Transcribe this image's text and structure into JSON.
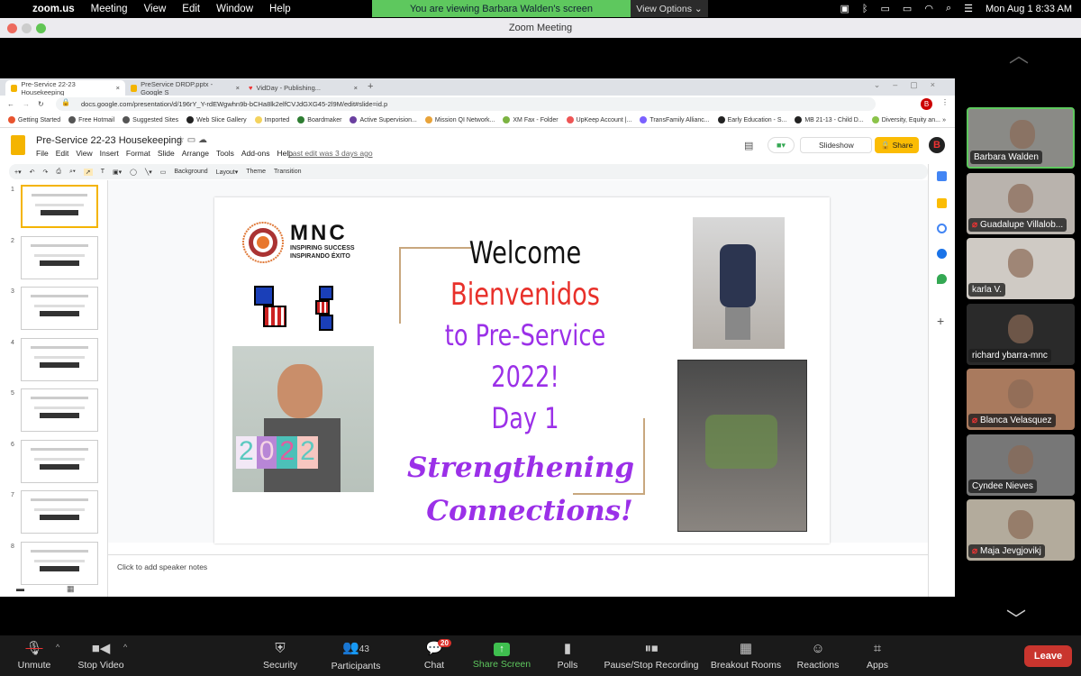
{
  "menubar": {
    "app": "zoom.us",
    "items": [
      "Meeting",
      "View",
      "Edit",
      "Window",
      "Help"
    ],
    "clock": "Mon Aug 1  8:33 AM"
  },
  "banner": {
    "viewing": "You are viewing Barbara Walden's screen",
    "view_options": "View Options ⌄"
  },
  "window": {
    "title": "Zoom Meeting"
  },
  "browser": {
    "tabs": [
      {
        "label": "Pre-Service 22-23 Housekeeping"
      },
      {
        "label": "PreService DRDP.pptx - Google S"
      },
      {
        "label": "VidDay - Publishing..."
      }
    ],
    "url": "docs.google.com/presentation/d/196rY_Y-rdEWgwhn9b-bCHa8lk2elfCVJdGXG45-2l9M/edit#slide=id.p",
    "bookmarks": [
      "Getting Started",
      "Free Hotmail",
      "Suggested Sites",
      "Web Slice Gallery",
      "Imported",
      "Boardmaker",
      "Active Supervision...",
      "Mission QI Network...",
      "XM Fax - Folder",
      "UpKeep Account |...",
      "TransFamily Allianc...",
      "Early Education - S...",
      "MB 21-13 - Child D...",
      "Diversity, Equity an..."
    ],
    "profile": "B"
  },
  "slides": {
    "doc_title": "Pre-Service 22-23 Housekeeping",
    "menu": [
      "File",
      "Edit",
      "View",
      "Insert",
      "Format",
      "Slide",
      "Arrange",
      "Tools",
      "Add-ons",
      "Help"
    ],
    "last_edit": "Last edit was 3 days ago",
    "slideshow": "Slideshow",
    "share": "Share",
    "toolbar": [
      "Background",
      "Layout▾",
      "Theme",
      "Transition"
    ],
    "thumb_numbers": [
      "1",
      "2",
      "3",
      "4",
      "5",
      "6",
      "7",
      "8"
    ],
    "speaker_notes": "Click to add speaker notes",
    "slide": {
      "logo_name": "MNC",
      "logo_tag1": "INSPIRING SUCCESS",
      "logo_tag2": "INSPIRANDO ÉXITO",
      "welcome": "Welcome",
      "bienvenidos": "Bienvenidos",
      "line3": "to Pre-Service",
      "line4": "2022!",
      "line5": "Day 1",
      "script1": "Strengthening",
      "script2": "Connections!",
      "sign": "2022"
    }
  },
  "participants": [
    {
      "name": "Barbara Walden",
      "muted": false,
      "active": true,
      "bg": "#8a8a86"
    },
    {
      "name": "Guadalupe Villalob...",
      "muted": true,
      "bg": "#b9b3ad"
    },
    {
      "name": "karla V.",
      "muted": false,
      "bg": "#cfcac4"
    },
    {
      "name": "richard ybarra-mnc",
      "muted": false,
      "bg": "#2a2a2a"
    },
    {
      "name": "Blanca Velasquez",
      "muted": true,
      "bg": "#a97a5e"
    },
    {
      "name": "Cyndee Nieves",
      "muted": false,
      "bg": "#777"
    },
    {
      "name": "Maja Jevgjovikj",
      "muted": true,
      "bg": "#b3ab9c"
    }
  ],
  "zoombar": {
    "unmute": "Unmute",
    "stop_video": "Stop Video",
    "security": "Security",
    "participants": "Participants",
    "participant_count": "43",
    "chat": "Chat",
    "chat_badge": "20",
    "share_screen": "Share Screen",
    "polls": "Polls",
    "recording": "Pause/Stop Recording",
    "breakout": "Breakout Rooms",
    "reactions": "Reactions",
    "apps": "Apps",
    "leave": "Leave"
  },
  "colors": {
    "zoom_green": "#5ec85e",
    "share_yellow": "#fbbc04",
    "leave_red": "#c9352e",
    "purple": "#9b30e8",
    "red": "#e8302a"
  }
}
